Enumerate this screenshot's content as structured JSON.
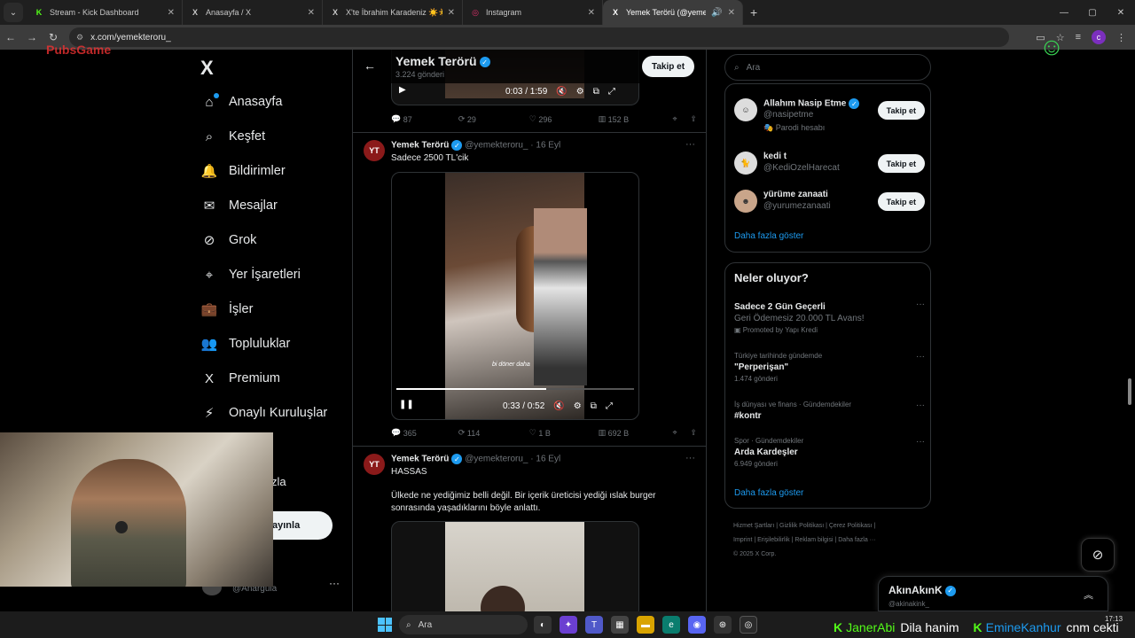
{
  "browser": {
    "tabs": [
      {
        "title": "Stream - Kick Dashboard",
        "icon": "K",
        "active": false
      },
      {
        "title": "Anasayfa / X",
        "icon": "X",
        "active": false
      },
      {
        "title": "X'te İbrahim Karadeniz ☀️☀️ 📍",
        "icon": "X",
        "active": false
      },
      {
        "title": "Instagram",
        "icon": "◎",
        "active": false
      },
      {
        "title": "Yemek Terörü (@yemekteroru_",
        "icon": "X",
        "active": true
      }
    ],
    "url": "x.com/yemekteroru_",
    "profile_initial": "c"
  },
  "overlay": {
    "logo_text": "PubsGame"
  },
  "sidebar": {
    "logo": "X",
    "items": [
      {
        "label": "Anasayfa",
        "icon": "⌂"
      },
      {
        "label": "Keşfet",
        "icon": "⌕"
      },
      {
        "label": "Bildirimler",
        "icon": "🔔"
      },
      {
        "label": "Mesajlar",
        "icon": "✉"
      },
      {
        "label": "Grok",
        "icon": "⊘"
      },
      {
        "label": "Yer İşaretleri",
        "icon": "⌖"
      },
      {
        "label": "İşler",
        "icon": "💼"
      },
      {
        "label": "Topluluklar",
        "icon": "👥"
      },
      {
        "label": "Premium",
        "icon": "X"
      },
      {
        "label": "Onaylı Kuruluşlar",
        "icon": "⚡"
      }
    ],
    "more_partial": "zla",
    "post_partial": "ayınla",
    "account_handle": "@Anargula",
    "account_more": "···"
  },
  "header": {
    "name": "Yemek Terörü",
    "post_count": "3.224 gönderi",
    "follow": "Takip et"
  },
  "tweets": [
    {
      "video_time": "0:03 / 1:59",
      "stats": {
        "reply": "87",
        "retweet": "29",
        "like": "296",
        "views": "152 B"
      }
    },
    {
      "name": "Yemek Terörü",
      "handle": "@yemekteroru_",
      "date": "16 Eyl",
      "text": "Sadece 2500 TL'cik",
      "video_time": "0:33 / 0:52",
      "video_caption": "bi döner daha",
      "video_progress": 0.63,
      "stats": {
        "reply": "365",
        "retweet": "114",
        "like": "1 B",
        "views": "692 B"
      }
    },
    {
      "name": "Yemek Terörü",
      "handle": "@yemekteroru_",
      "date": "16 Eyl",
      "text1": "HASSAS",
      "text2": "Ülkede ne yediğimiz belli değil. Bir içerik üreticisi yediği ıslak burger sonrasında yaşadıklarını böyle anlattı."
    }
  ],
  "right": {
    "search_placeholder": "Ara",
    "suggestions": [
      {
        "name": "Allahım Nasip Etme",
        "handle": "@nasipetme",
        "extra": "Parodi hesabı",
        "verified": true,
        "follow": "Takip et"
      },
      {
        "name": "kedi t",
        "handle": "@KediOzelHarecat",
        "extra": "",
        "verified": false,
        "follow": "Takip et"
      },
      {
        "name": "yürüme zanaati",
        "handle": "@yurumezanaati",
        "extra": "",
        "verified": false,
        "follow": "Takip et"
      }
    ],
    "show_more": "Daha fazla göster",
    "trends_title": "Neler oluyor?",
    "trends": [
      {
        "ctx": "",
        "title": "Sadece 2 Gün Geçerli",
        "sub": "Geri Ödemesiz 20.000 TL Avans!",
        "count": "Promoted by Yapı Kredi"
      },
      {
        "ctx": "Türkiye tarihinde gündemde",
        "title": "\"Perperişan\"",
        "sub": "",
        "count": "1.474 gönderi"
      },
      {
        "ctx": "İş dünyası ve finans · Gündemdekiler",
        "title": "#kontr",
        "sub": "",
        "count": ""
      },
      {
        "ctx": "Spor · Gündemdekiler",
        "title": "Arda Kardeşler",
        "sub": "",
        "count": "6.949 gönderi"
      }
    ],
    "trends_more": "Daha fazla göster",
    "footer_line1": "Hizmet Şartları | Gizlilik Politikası | Çerez Politikası |",
    "footer_line2": "Imprint | Erişilebilirlik | Reklam bilgisi | Daha fazla ···",
    "footer_line3": "© 2025 X Corp."
  },
  "messages": {
    "name": "AkınAkınK",
    "handle": "@akinakink_"
  },
  "taskbar": {
    "search": "Ara",
    "time": "17:13"
  },
  "chat_ticker": [
    {
      "user": "JanerAbi",
      "msg": "Dila hanim",
      "color": "#53fc18"
    },
    {
      "user": "EmineKanhur",
      "msg": "cnm cekti",
      "color": "#1d9bf0"
    }
  ]
}
